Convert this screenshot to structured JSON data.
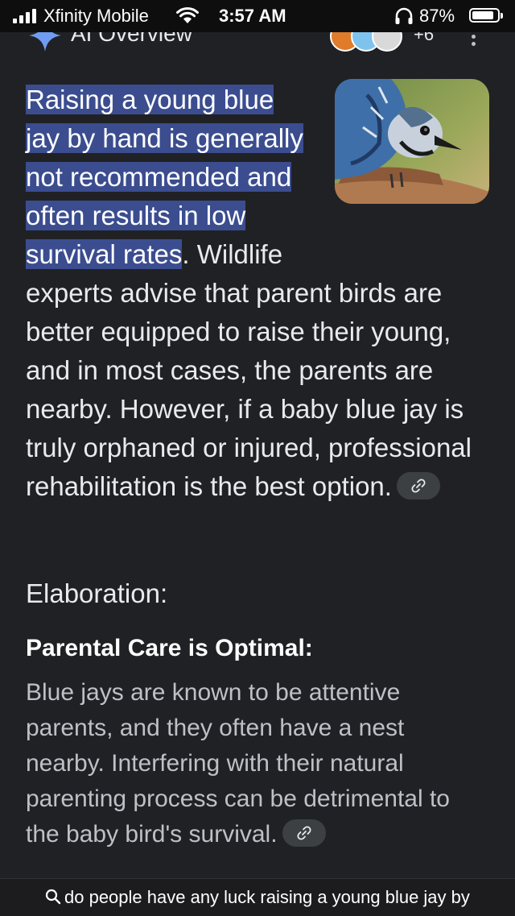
{
  "status_bar": {
    "carrier": "Xfinity Mobile",
    "time": "3:57 AM",
    "battery_percent": "87%",
    "battery_level": 0.87,
    "icons": [
      "signal-icon",
      "wifi-icon",
      "headphones-icon",
      "battery-icon"
    ]
  },
  "header": {
    "title": "AI Overview",
    "sources_more": "+6",
    "icons": [
      "gemini-sparkle-icon",
      "more-options-icon"
    ]
  },
  "answer": {
    "highlight": "Raising a young blue jay by hand is generally not recommended and often results in low survival rates",
    "rest": ". Wildlife experts advise that parent birds are better equipped to raise their young, and in most cases, the parents are nearby. However, if a baby blue jay is truly orphaned or injured, professional rehabilitation is the best option.",
    "image_subject": "blue jay"
  },
  "elaboration": {
    "heading": "Elaboration:",
    "section_title": "Parental Care is Optimal:",
    "section_body": "Blue jays are known to be attentive parents, and they often have a nest nearby. Interfering with their natural parenting process can be detrimental to the baby bird's survival."
  },
  "bottom_bar": {
    "query": "do people have any luck raising a young blue jay by hand"
  },
  "colors": {
    "background": "#202124",
    "highlight": "#3b4d8f",
    "text": "#e8eaed"
  }
}
